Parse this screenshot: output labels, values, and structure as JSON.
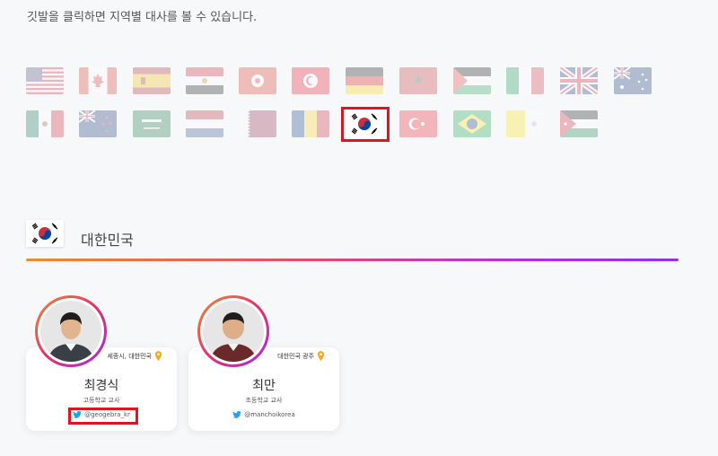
{
  "page": {
    "instruction": "깃발을 클릭하면 지역별 대사를 볼 수 있습니다."
  },
  "flags": {
    "row1": [
      "usa-flag-icon",
      "canada-flag-icon",
      "spain-flag-icon",
      "egypt-flag-icon",
      "hong-kong-flag-icon",
      "tunisia-flag-icon",
      "germany-flag-icon",
      "morocco-flag-icon",
      "palestine-flag-icon",
      "italy-flag-icon",
      "uk-flag-icon",
      "australia-flag-icon"
    ],
    "row2": [
      "mexico-flag-icon",
      "new-zealand-flag-icon",
      "saudi-arabia-flag-icon",
      "netherlands-flag-icon",
      "qatar-flag-icon",
      "romania-flag-icon",
      "south-korea-flag-icon",
      "turkey-flag-icon",
      "brazil-flag-icon",
      "vatican-flag-icon",
      "jordan-flag-icon"
    ],
    "selected": "south-korea-flag-icon"
  },
  "country": {
    "name": "대한민국",
    "flag_icon": "south-korea-flag-icon"
  },
  "colors": {
    "highlight": "#e0141e",
    "gradient_start": "#f28a2e",
    "gradient_end": "#8f2ef2",
    "twitter": "#1da1f2",
    "pin": "#f5a623"
  },
  "ambassadors": [
    {
      "name": "최경식",
      "location": "세종시, 대한민국",
      "role": "고등학교 교사",
      "twitter": "@geogebra_kr"
    },
    {
      "name": "최만",
      "location": "대한민국 광주",
      "role": "초등학교 교사",
      "twitter": "@manchoikorea"
    }
  ]
}
